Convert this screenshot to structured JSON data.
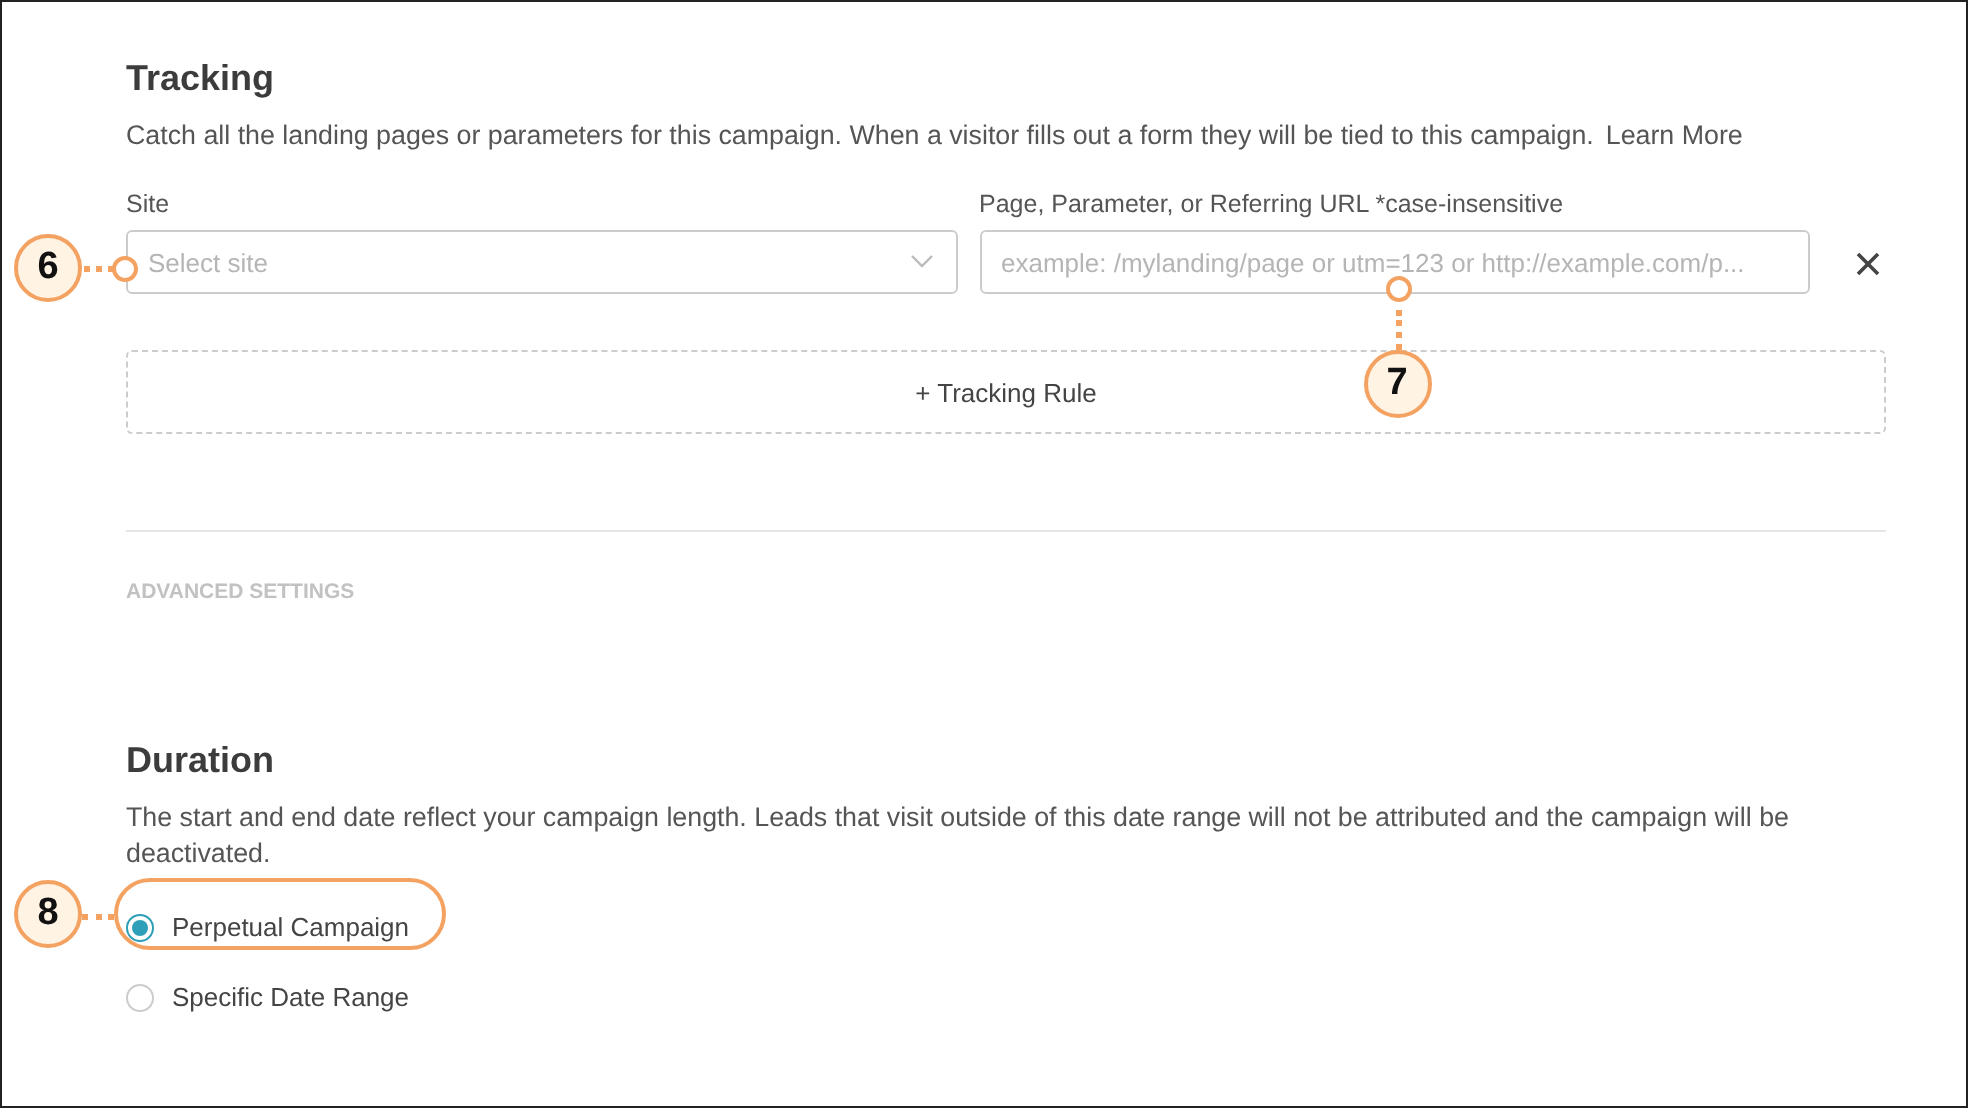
{
  "tracking": {
    "title": "Tracking",
    "description": "Catch all the landing pages or parameters for this campaign. When a visitor fills out a form they will be tied to this campaign.",
    "learn_more": "Learn More",
    "site_field": {
      "label": "Site",
      "placeholder": "Select site",
      "callout": "6"
    },
    "url_field": {
      "label": "Page, Parameter, or Referring URL *case-insensitive",
      "placeholder": "example: /mylanding/page or utm=123 or http://example.com/p...",
      "callout": "7"
    },
    "add_rule": "+ Tracking Rule"
  },
  "advanced_settings": "ADVANCED SETTINGS",
  "duration": {
    "title": "Duration",
    "description": "The start and end date reflect your campaign length. Leads that visit outside of this date range will not be attributed and the campaign will be deactivated.",
    "options": [
      {
        "label": "Perpetual Campaign",
        "selected": true,
        "callout": "8"
      },
      {
        "label": "Specific Date Range",
        "selected": false
      }
    ]
  }
}
